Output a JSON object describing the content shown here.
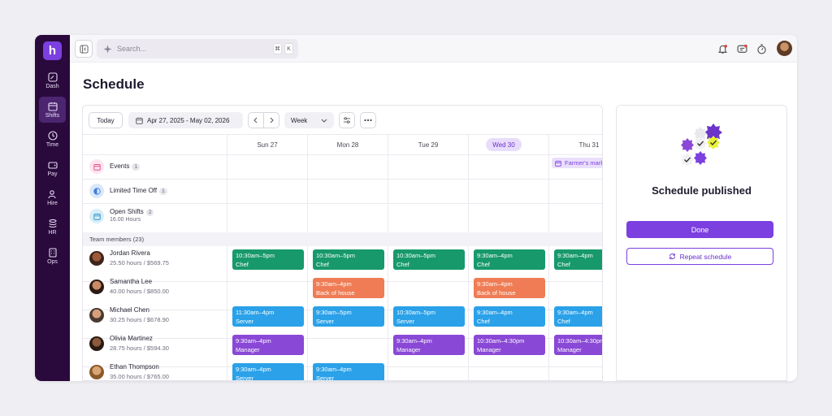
{
  "app": {
    "logo_letter": "h"
  },
  "sidebar": {
    "items": [
      {
        "label": "Dash",
        "icon": "dashboard-icon"
      },
      {
        "label": "Shifts",
        "icon": "calendar-icon"
      },
      {
        "label": "Time",
        "icon": "clock-icon"
      },
      {
        "label": "Pay",
        "icon": "wallet-icon"
      },
      {
        "label": "Hire",
        "icon": "people-icon"
      },
      {
        "label": "HR",
        "icon": "stack-icon"
      },
      {
        "label": "Ops",
        "icon": "building-icon"
      }
    ],
    "active": "Shifts"
  },
  "topbar": {
    "search_placeholder": "Search...",
    "shortcut_keys": [
      "⌘",
      "K"
    ]
  },
  "page": {
    "title": "Schedule"
  },
  "toolbar": {
    "today": "Today",
    "date_range": "Apr 27, 2025 - May 02, 2026",
    "view": "Week"
  },
  "days": [
    "Sun 27",
    "Mon 28",
    "Tue 29",
    "Wed 30",
    "Thu 31"
  ],
  "today_day": "Wed 30",
  "categories": [
    {
      "label": "Events",
      "count": "1",
      "sub": ""
    },
    {
      "label": "Limited Time Off",
      "count": "1",
      "sub": ""
    },
    {
      "label": "Open Shifts",
      "count": "2",
      "sub": "16.00 Hours"
    }
  ],
  "event_chip": "Farmer's market",
  "team_header": "Team members (23)",
  "members": [
    {
      "name": "Jordan Rivera",
      "hours": "25.50 hours / $569.75"
    },
    {
      "name": "Samantha Lee",
      "hours": "40.00 hours / $850.00"
    },
    {
      "name": "Michael Chen",
      "hours": "30.25 hours / $678.90"
    },
    {
      "name": "Olivia Martinez",
      "hours": "28.75 hours / $594.30"
    },
    {
      "name": "Ethan Thompson",
      "hours": "35.00 hours / $765.00"
    }
  ],
  "shifts": {
    "r0d0": {
      "time": "10:30am–5pm",
      "role": "Chef"
    },
    "r0d1": {
      "time": "10:30am–5pm",
      "role": "Chef"
    },
    "r0d2": {
      "time": "10:30am–5pm",
      "role": "Chef"
    },
    "r0d3": {
      "time": "9:30am–4pm",
      "role": "Chef"
    },
    "r0d4": {
      "time": "9:30am–4pm",
      "role": "Chef"
    },
    "r1d1": {
      "time": "9:30am–4pm",
      "role": "Back of house"
    },
    "r1d3": {
      "time": "9:30am–4pm",
      "role": "Back of house"
    },
    "r2d0": {
      "time": "11:30am–4pm",
      "role": "Server"
    },
    "r2d1": {
      "time": "9:30am–5pm",
      "role": "Server"
    },
    "r2d2": {
      "time": "10:30am–5pm",
      "role": "Server"
    },
    "r2d3": {
      "time": "9:30am–4pm",
      "role": "Chef"
    },
    "r2d4": {
      "time": "9:30am–4pm",
      "role": "Chef"
    },
    "r3d0": {
      "time": "9:30am–4pm",
      "role": "Manager"
    },
    "r3d2": {
      "time": "9:30am–4pm",
      "role": "Manager"
    },
    "r3d3": {
      "time": "10:30am–4:30pm",
      "role": "Manager"
    },
    "r3d4": {
      "time": "10:30am–4:30pm",
      "role": "Manager"
    },
    "r4d0": {
      "time": "9:30am–4pm",
      "role": "Server"
    },
    "r4d1": {
      "time": "9:30am–4pm",
      "role": "Server"
    }
  },
  "panel": {
    "title": "Schedule published",
    "done": "Done",
    "repeat": "Repeat schedule"
  },
  "colors": {
    "brand": "#7c3fe0",
    "sidebar": "#2a0a3d",
    "chef": "#17996b",
    "back_of_house": "#ef7c54",
    "server": "#2aa1e8",
    "manager": "#8a48d6"
  }
}
